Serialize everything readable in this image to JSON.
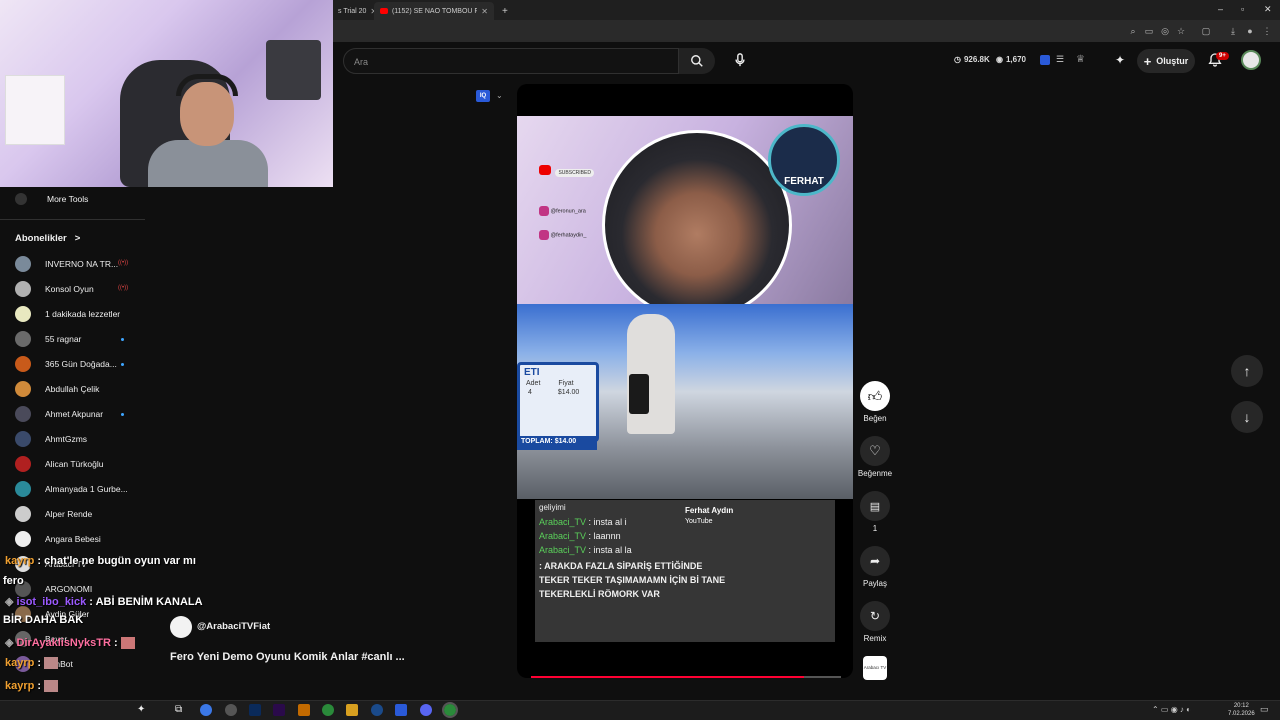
{
  "browser": {
    "tabs": [
      {
        "label": "s Trial 20"
      },
      {
        "label": "(1152) SE NÃO TOMBOU FOI M"
      }
    ],
    "new_tab": "+",
    "window_controls": [
      "–",
      "▫",
      "✕"
    ]
  },
  "masthead": {
    "search_placeholder": "Ara",
    "stats": {
      "views_a": "926.8K",
      "views_b": "1,670"
    },
    "create_label": "Oluştur",
    "notifications_badge": "9+"
  },
  "sidebar": {
    "more_tools": "More Tools",
    "subscriptions_header": "Abonelikler",
    "subscriptions_chevron": ">",
    "items": [
      {
        "label": "INVERNO NA TR...",
        "color": "#7a8a9a",
        "live": true
      },
      {
        "label": "Konsol Oyun",
        "color": "#b0b0b0",
        "live": true
      },
      {
        "label": "1 dakikada lezzetler",
        "color": "#e8e8c0",
        "live": false
      },
      {
        "label": "55 ragnar",
        "color": "#6a6a6a",
        "dot": true
      },
      {
        "label": "365 Gün Doğada...",
        "color": "#c85a1a",
        "dot": true
      },
      {
        "label": "Abdullah Çelik",
        "color": "#d08a3a",
        "live": false
      },
      {
        "label": "Ahmet Akpunar",
        "color": "#4a4a5a",
        "dot": true
      },
      {
        "label": "AhmtGzms",
        "color": "#3a4a6a",
        "live": false
      },
      {
        "label": "Alican Türkoğlu",
        "color": "#b02020",
        "live": false
      },
      {
        "label": "Almanyada 1 Gurbe...",
        "color": "#2a8a9a",
        "live": false
      },
      {
        "label": "Alper Rende",
        "color": "#ccc",
        "live": false
      },
      {
        "label": "Angara Bebesi",
        "color": "#eee",
        "live": false
      },
      {
        "label": "Arabacı Tv",
        "color": "#ddd",
        "live": false
      },
      {
        "label": "ARGONOMI",
        "color": "#555",
        "live": false
      },
      {
        "label": "Aydin Güler",
        "color": "#8a6a4a",
        "live": false
      },
      {
        "label": "Bayer",
        "color": "#666",
        "live": false
      },
      {
        "label": "BenBot",
        "color": "#7a5a9a",
        "live": false
      }
    ]
  },
  "chat": [
    {
      "user": "kayrp",
      "text": ": chat'le ne bugün oyun var mı"
    },
    {
      "user": "",
      "text": "fero"
    },
    {
      "user": "isot_ibo_kick",
      "text": ": ABİ BENİM KANALA"
    },
    {
      "user": "",
      "text": "BİR DAHA BAK"
    },
    {
      "user": "DirAyaklisNyksTR",
      "text": ":"
    },
    {
      "user": "kayrp",
      "text": ":"
    },
    {
      "user": "kayrp",
      "text": ":"
    },
    {
      "user": "kayrp",
      "text": ":"
    }
  ],
  "video": {
    "channel_handle": "@ArabaciTVFiat",
    "title": "Fero Yeni Demo Oyunu Komik Anlar #canlı ...",
    "overlay_brand": "FERHAT",
    "overlay_socials": [
      "SUBSCRIBED",
      "@feronun_ara",
      "@ferhataydin_"
    ],
    "receipt": {
      "adet_label": "Adet",
      "fiyat_label": "Fiyat",
      "adet": "4",
      "fiyat": "$14.00",
      "toplam": "TOPLAM: $14.00",
      "eti": "ETI"
    },
    "stream_chat": {
      "header": "geliyimi",
      "lines": [
        {
          "user": "Arabaci_TV",
          "text": ": insta al i"
        },
        {
          "user": "Arabaci_TV",
          "text": ": laannn"
        },
        {
          "user": "Arabaci_TV",
          "text": ": insta al la"
        },
        {
          "user": "",
          "text": ": ARAKDA FAZLA SİPARİŞ ETTİĞİNDE TEKER TEKER TAŞIMAMAMN İÇİN Bİ TANE TEKERLEKLİ RÖMORK VAR"
        }
      ],
      "banner": "Ferhat Aydın",
      "banner2": "YouTube"
    },
    "progress": 0.88
  },
  "actions": {
    "like": "Beğen",
    "dislike": "Beğenme",
    "comments": "1",
    "share": "Paylaş",
    "remix": "Remix",
    "channel_thumb": "Arabacı TV"
  },
  "tray": {
    "time": "20:12",
    "date": "7.02.2026"
  },
  "colors": {
    "accent_red": "#ff0033",
    "bg": "#0f0f0f",
    "chip": "#272727"
  }
}
